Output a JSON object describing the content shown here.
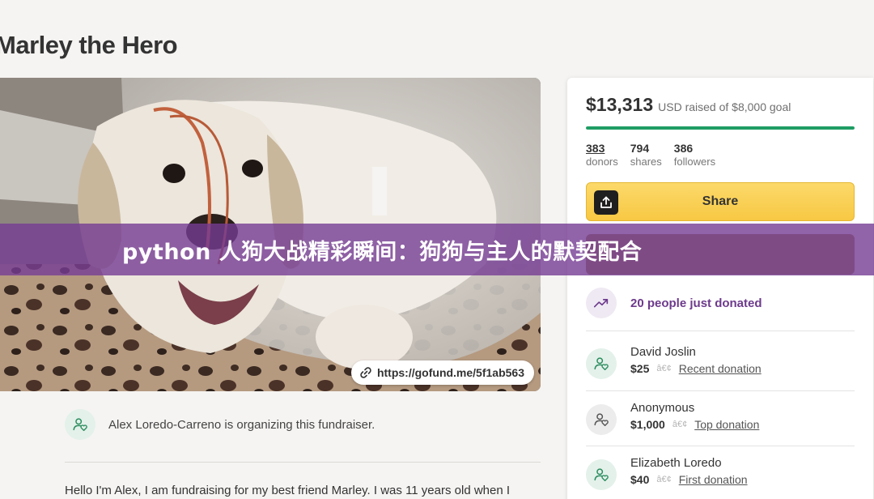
{
  "page": {
    "title": "Marley the Hero"
  },
  "hero": {
    "url_chip": "https://gofund.me/5f1ab563"
  },
  "organizer": {
    "text": "Alex Loredo-Carreno is organizing this fundraiser."
  },
  "story": {
    "text": "Hello I'm Alex, I am fundraising for my best friend Marley. I was 11 years old when I"
  },
  "donation": {
    "amount_raised": "$13,313",
    "raised_text": "USD raised of $8,000 goal",
    "progress_fraction": 1.0,
    "accent_color": "#1f9d64",
    "stats": [
      {
        "value": "383",
        "label": "donors"
      },
      {
        "value": "794",
        "label": "shares"
      },
      {
        "value": "386",
        "label": "followers"
      }
    ],
    "share_label": "Share",
    "trend_text": "20 people just donated",
    "donors": [
      {
        "name": "David Joslin",
        "amount": "$25",
        "sep": "â€¢",
        "tag": "Recent donation",
        "avatar_icon": "heart-hand-icon"
      },
      {
        "name": "Anonymous",
        "amount": "$1,000",
        "sep": "â€¢",
        "tag": "Top donation",
        "avatar_icon": "heart-hand-icon"
      },
      {
        "name": "Elizabeth Loredo",
        "amount": "$40",
        "sep": "â€¢",
        "tag": "First donation",
        "avatar_icon": "heart-hand-icon"
      }
    ]
  },
  "banner": {
    "text": "python 人狗大战精彩瞬间：狗狗与主人的默契配合"
  }
}
